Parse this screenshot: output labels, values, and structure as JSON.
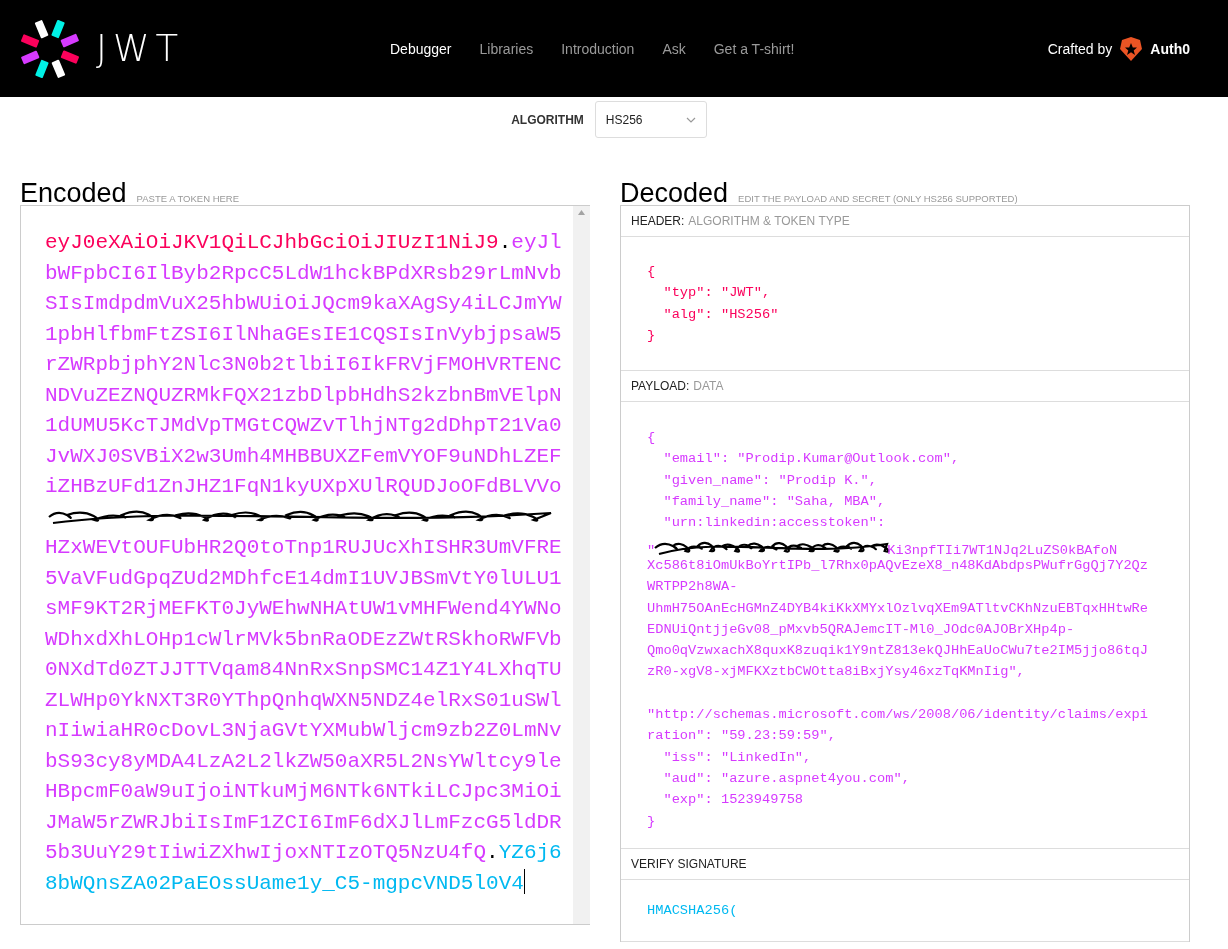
{
  "nav": {
    "logo_text": "JWT",
    "links": [
      {
        "label": "Debugger",
        "selected": true
      },
      {
        "label": "Libraries",
        "selected": false
      },
      {
        "label": "Introduction",
        "selected": false
      },
      {
        "label": "Ask",
        "selected": false
      },
      {
        "label": "Get a T-shirt!",
        "selected": false
      }
    ],
    "crafted_by": "Crafted by",
    "brand": "Auth0"
  },
  "algorithm": {
    "label": "ALGORITHM",
    "value": "HS256"
  },
  "encoded": {
    "title": "Encoded",
    "subtitle": "PASTE A TOKEN HERE",
    "lines": [
      {
        "kind": "text",
        "segments": [
          {
            "color": "#fb015b",
            "text": "eyJ0eXAiOiJKV1QiLCJhbGciOiJIUzI1NiJ9"
          },
          {
            "color": "#000000",
            "text": "."
          },
          {
            "color": "#d63aff",
            "text": "eyJl"
          }
        ]
      },
      {
        "kind": "text",
        "segments": [
          {
            "color": "#d63aff",
            "text": "bWFpbCI6IlByb2RpcC5LdW1hckBPdXRsb29rLmNvb"
          }
        ]
      },
      {
        "kind": "text",
        "segments": [
          {
            "color": "#d63aff",
            "text": "SIsImdpdmVuX25hbWUiOiJQcm9kaXAgSy4iLCJmYW"
          }
        ]
      },
      {
        "kind": "text",
        "segments": [
          {
            "color": "#d63aff",
            "text": "1pbHlfbmFtZSI6IlNhaGEsIE1CQSIsInVybjpsaW5"
          }
        ]
      },
      {
        "kind": "text",
        "segments": [
          {
            "color": "#d63aff",
            "text": "rZWRpbjphY2Nlc3N0b2tlbiI6IkFRVjFMOHVRTENC"
          }
        ]
      },
      {
        "kind": "text",
        "segments": [
          {
            "color": "#d63aff",
            "text": "NDVuZEZNQUZRMkFQX21zbDlpbHdhS2kzbnBmVElpN"
          }
        ]
      },
      {
        "kind": "text",
        "segments": [
          {
            "color": "#d63aff",
            "text": "1dUMU5KcTJMdVpTMGtCQWZvTlhjNTg2dDhpT21Va0"
          }
        ]
      },
      {
        "kind": "text",
        "segments": [
          {
            "color": "#d63aff",
            "text": "JvWXJ0SVBiX2w3Umh4MHBBUXZFemVYOF9uNDhLZEF"
          }
        ]
      },
      {
        "kind": "text",
        "segments": [
          {
            "color": "#d63aff",
            "text": "iZHBzUFd1ZnJHZ1FqN1kyUXpXUlRQUDJoOFdBLVVo"
          }
        ]
      },
      {
        "kind": "redacted"
      },
      {
        "kind": "text",
        "segments": [
          {
            "color": "#d63aff",
            "text": "HZxWEVtOUFUbHR2Q0toTnp1RUJUcXhISHR3UmVFRE"
          }
        ]
      },
      {
        "kind": "text",
        "segments": [
          {
            "color": "#d63aff",
            "text": "5VaVFudGpqZUd2MDhfcE14dmI1UVJBSmVtY0lULU1"
          }
        ]
      },
      {
        "kind": "text",
        "segments": [
          {
            "color": "#d63aff",
            "text": "sMF9KT2RjMEFKT0JyWEhwNHAtUW1vMHFWend4YWNo"
          }
        ]
      },
      {
        "kind": "text",
        "segments": [
          {
            "color": "#d63aff",
            "text": "WDhxdXhLOHp1cWlrMVk5bnRaODEzZWtRSkhoRWFVb"
          }
        ]
      },
      {
        "kind": "text",
        "segments": [
          {
            "color": "#d63aff",
            "text": "0NXdTd0ZTJJTTVqam84NnRxSnpSMC14Z1Y4LXhqTU"
          }
        ]
      },
      {
        "kind": "text",
        "segments": [
          {
            "color": "#d63aff",
            "text": "ZLWHp0YkNXT3R0YThpQnhqWXN5NDZ4elRxS01uSWl"
          }
        ]
      },
      {
        "kind": "text",
        "segments": [
          {
            "color": "#d63aff",
            "text": "nIiwiaHR0cDovL3NjaGVtYXMubWljcm9zb2Z0LmNv"
          }
        ]
      },
      {
        "kind": "text",
        "segments": [
          {
            "color": "#d63aff",
            "text": "bS93cy8yMDA4LzA2L2lkZW50aXR5L2NsYWltcy9le"
          }
        ]
      },
      {
        "kind": "text",
        "segments": [
          {
            "color": "#d63aff",
            "text": "HBpcmF0aW9uIjoiNTkuMjM6NTk6NTkiLCJpc3MiOi"
          }
        ]
      },
      {
        "kind": "text",
        "segments": [
          {
            "color": "#d63aff",
            "text": "JMaW5rZWRJbiIsImF1ZCI6ImF6dXJlLmFzcG5ldDR"
          }
        ]
      },
      {
        "kind": "text",
        "segments": [
          {
            "color": "#d63aff",
            "text": "5b3UuY29tIiwiZXhwIjoxNTIzOTQ5NzU4fQ"
          },
          {
            "color": "#000000",
            "text": "."
          },
          {
            "color": "#00b9f1",
            "text": "YZ6j6"
          }
        ]
      },
      {
        "kind": "text",
        "segments": [
          {
            "color": "#00b9f1",
            "text": "8bWQnsZA02PaEOssUame1y_C5-mgpcVND5l0V4"
          }
        ],
        "cursor": true
      }
    ]
  },
  "decoded": {
    "title": "Decoded",
    "subtitle": "EDIT THE PAYLOAD AND SECRET (ONLY HS256 SUPPORTED)",
    "sections": [
      {
        "kind": "header",
        "title": "HEADER:",
        "title_note": "ALGORITHM & TOKEN TYPE",
        "lines": [
          {
            "kind": "text",
            "text": "{"
          },
          {
            "kind": "text",
            "text": "  \"typ\": \"JWT\","
          },
          {
            "kind": "text",
            "text": "  \"alg\": \"HS256\""
          },
          {
            "kind": "text",
            "text": "}"
          }
        ]
      },
      {
        "kind": "payload",
        "title": "PAYLOAD:",
        "title_note": "DATA",
        "lines": [
          {
            "kind": "text",
            "text": "{"
          },
          {
            "kind": "text",
            "text": "  \"email\": \"Prodip.Kumar@Outlook.com\","
          },
          {
            "kind": "text",
            "text": "  \"given_name\": \"Prodip K.\","
          },
          {
            "kind": "text",
            "text": "  \"family_name\": \"Saha, MBA\","
          },
          {
            "kind": "text",
            "text": "  \"urn:linkedin:accesstoken\":"
          },
          {
            "kind": "redacted",
            "before": "\"",
            "after": "Ki3npfTIi7WT1NJq2LuZS0kBAfoN"
          },
          {
            "kind": "text",
            "text": "Xc586t8iOmUkBoYrtIPb_l7Rhx0pAQvEzeX8_n48KdAbdpsPWufrGgQj7Y2Qz"
          },
          {
            "kind": "text",
            "text": "WRTPP2h8WA-"
          },
          {
            "kind": "text",
            "text": "UhmH75OAnEcHGMnZ4DYB4kiKkXMYxlOzlvqXEm9ATltvCKhNzuEBTqxHHtwRe"
          },
          {
            "kind": "text",
            "text": "EDNUiQntjjeGv08_pMxvb5QRAJemcIT-Ml0_JOdc0AJOBrXHp4p-"
          },
          {
            "kind": "text",
            "text": "Qmo0qVzwxachX8quxK8zuqik1Y9ntZ813ekQJHhEaUoCWu7te2IM5jjo86tqJ"
          },
          {
            "kind": "text",
            "text": "zR0-xgV8-xjMFKXztbCWOtta8iBxjYsy46xzTqKMnIig\","
          },
          {
            "kind": "blank"
          },
          {
            "kind": "text",
            "text": "\"http://schemas.microsoft.com/ws/2008/06/identity/claims/expi"
          },
          {
            "kind": "text",
            "text": "ration\": \"59.23:59:59\","
          },
          {
            "kind": "text",
            "text": "  \"iss\": \"LinkedIn\","
          },
          {
            "kind": "text",
            "text": "  \"aud\": \"azure.aspnet4you.com\","
          },
          {
            "kind": "text",
            "text": "  \"exp\": 1523949758"
          },
          {
            "kind": "text",
            "text": "}"
          }
        ]
      },
      {
        "kind": "verify",
        "title": "VERIFY SIGNATURE",
        "lines": [
          {
            "kind": "text",
            "text": "HMACSHA256("
          }
        ]
      }
    ]
  }
}
